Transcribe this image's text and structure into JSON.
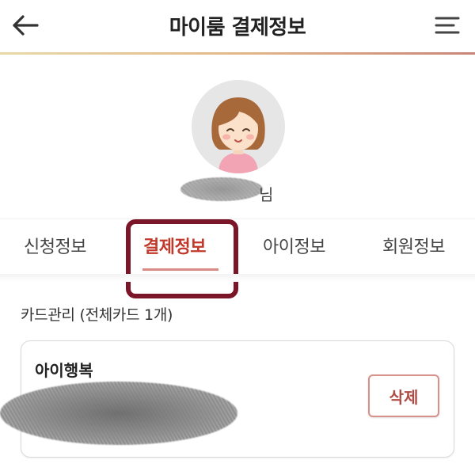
{
  "header": {
    "title": "마이룸 결제정보",
    "back_icon": "arrow-left-icon",
    "menu_icon": "hamburger-menu-icon"
  },
  "profile": {
    "avatar_icon": "girl-avatar-icon",
    "name_suffix": "님"
  },
  "tabs": [
    {
      "label": "신청정보",
      "active": false
    },
    {
      "label": "결제정보",
      "active": true
    },
    {
      "label": "아이정보",
      "active": false
    },
    {
      "label": "회원정보",
      "active": false
    }
  ],
  "card_section": {
    "label": "카드관리 (전체카드 1개)",
    "cards": [
      {
        "name": "아이행복",
        "delete_label": "삭제"
      }
    ]
  },
  "colors": {
    "accent": "#c0392b",
    "highlight_box": "#7b1528",
    "tab_underline": "#d98a85"
  }
}
